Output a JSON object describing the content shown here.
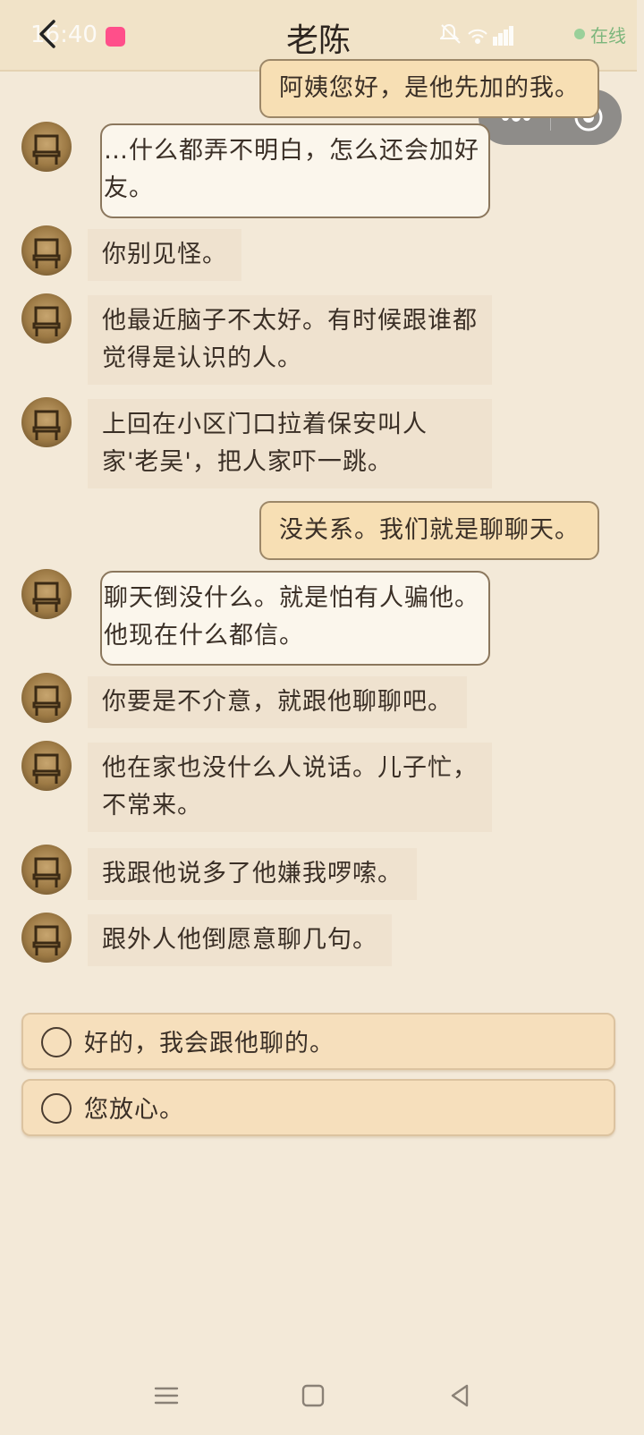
{
  "header": {
    "status_time": "16:40",
    "title": "老陈",
    "online_label": "在线",
    "back_icon": "back-arrow-icon",
    "status_icons": [
      "mute-icon",
      "wifi-icon",
      "5g-signal-icon",
      "battery-icon"
    ]
  },
  "capsule": {
    "more_icon": "more-dots-icon",
    "close_icon": "target-circle-icon"
  },
  "messages": [
    {
      "sender": "me",
      "text": "阿姨您好，是他先加的我。"
    },
    {
      "sender": "other",
      "style": "outlined",
      "text": "…什么都弄不明白，怎么还会加好友。"
    },
    {
      "sender": "other",
      "style": "plain",
      "text": "你别见怪。"
    },
    {
      "sender": "other",
      "style": "plain",
      "text": "他最近脑子不太好。有时候跟谁都觉得是认识的人。"
    },
    {
      "sender": "other",
      "style": "plain",
      "text": "上回在小区门口拉着保安叫人家'老吴'，把人家吓一跳。"
    },
    {
      "sender": "me",
      "text": "没关系。我们就是聊聊天。"
    },
    {
      "sender": "other",
      "style": "outlined",
      "text": "聊天倒没什么。就是怕有人骗他。他现在什么都信。"
    },
    {
      "sender": "other",
      "style": "plain",
      "text": "你要是不介意，就跟他聊聊吧。"
    },
    {
      "sender": "other",
      "style": "plain",
      "text": "他在家也没什么人说话。儿子忙，不常来。"
    },
    {
      "sender": "other",
      "style": "plain",
      "text": "我跟他说多了他嫌我啰嗦。"
    },
    {
      "sender": "other",
      "style": "plain",
      "text": "跟外人他倒愿意聊几句。"
    }
  ],
  "options": [
    {
      "text": "好的，我会跟他聊的。"
    },
    {
      "text": "您放心。"
    }
  ],
  "navbar": {
    "icons": [
      "menu-icon",
      "home-square-icon",
      "back-triangle-icon"
    ]
  },
  "colors": {
    "background": "#f3e9d8",
    "my_bubble": "#f7dfb4",
    "online": "#7cb67c"
  }
}
